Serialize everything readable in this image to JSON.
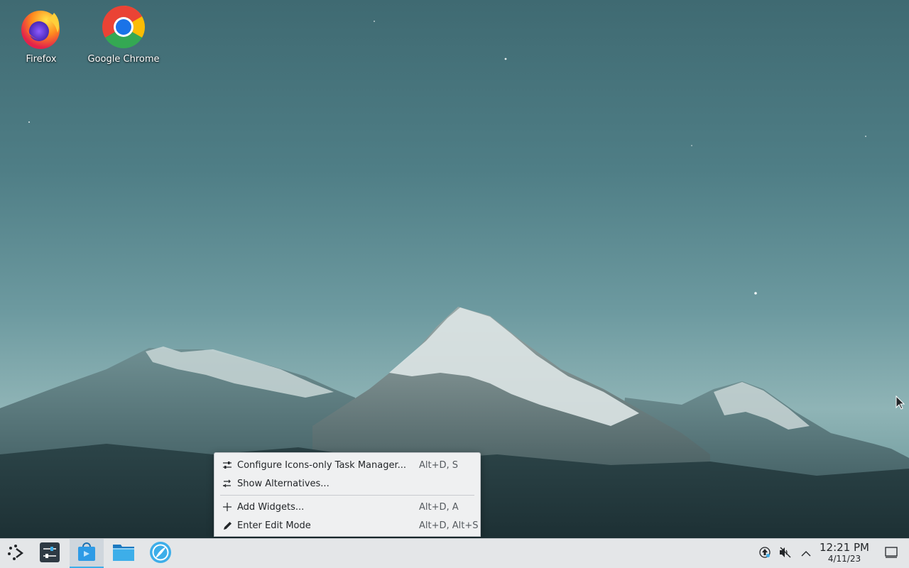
{
  "desktop": {
    "icons": [
      {
        "label": "Firefox",
        "icon": "firefox-icon"
      },
      {
        "label": "Google Chrome",
        "icon": "chrome-icon"
      }
    ]
  },
  "context_menu": {
    "items": [
      {
        "label": "Configure Icons-only Task Manager...",
        "shortcut": "Alt+D, S",
        "icon": "configure-icon"
      },
      {
        "label": "Show Alternatives...",
        "shortcut": "",
        "icon": "alternatives-icon"
      },
      {
        "label": "Add Widgets...",
        "shortcut": "Alt+D, A",
        "icon": "plus-icon"
      },
      {
        "label": "Enter Edit Mode",
        "shortcut": "Alt+D, Alt+S",
        "icon": "pencil-icon"
      }
    ]
  },
  "taskbar": {
    "launcher_icon": "application-launcher-icon",
    "tasks": [
      {
        "app": "System Settings",
        "icon": "settings-icon"
      },
      {
        "app": "Discover",
        "icon": "discover-icon"
      },
      {
        "app": "Dolphin",
        "icon": "folder-icon"
      },
      {
        "app": "Web Browser",
        "icon": "browser-icon"
      }
    ],
    "tray": {
      "icons": [
        "updates-icon",
        "volume-muted-icon",
        "chevron-up-icon"
      ],
      "time": "12:21 PM",
      "date": "4/11/23"
    },
    "show_desktop_icon": "show-desktop-icon"
  },
  "colors": {
    "accent": "#3daee9",
    "panel": "#e4e6e8",
    "menu_bg": "#eff0f1"
  }
}
